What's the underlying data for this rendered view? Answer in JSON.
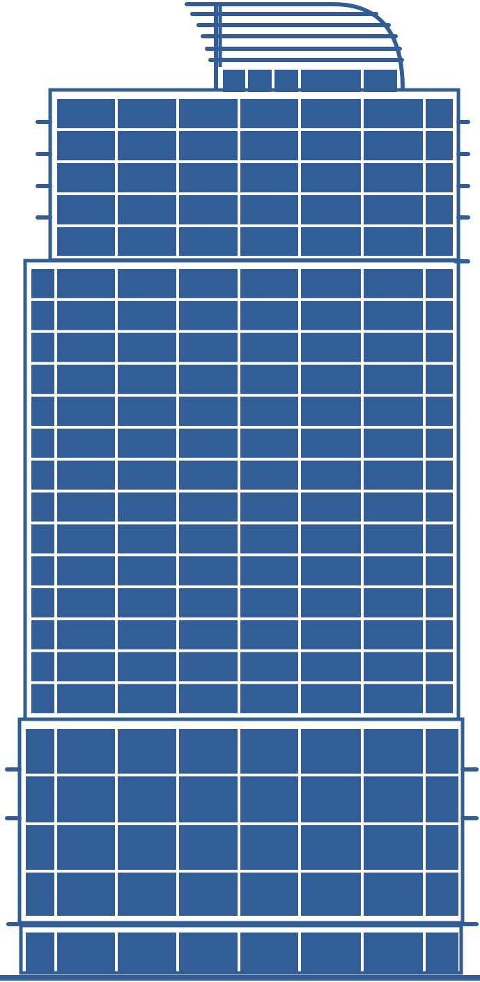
{
  "colors": {
    "primary": "#325e95",
    "background": "#ffffff"
  },
  "icons": {
    "main": "skyscraper-icon"
  },
  "building": {
    "sections": [
      "crown",
      "upper-tier",
      "middle-tier",
      "lower-tier",
      "base"
    ]
  }
}
